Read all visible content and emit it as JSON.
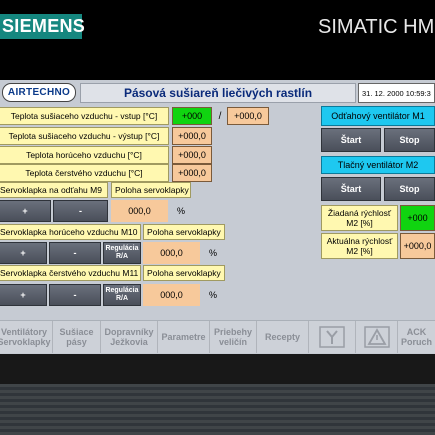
{
  "device": {
    "brand": "SIEMENS",
    "model": "SIMATIC HMI"
  },
  "header": {
    "logo": "AIRTECHNO",
    "title": "Pásová sušiareň liečivých rastlín",
    "datetime": "31. 12. 2000 10:59:3"
  },
  "temperatures": [
    {
      "label": "Teplota sušiaceho vzduchu - vstup [°C]",
      "value": "+000",
      "setpoint": "+000,0",
      "separator": "/"
    },
    {
      "label": "Teplota sušiaceho vzduchu - výstup [°C]",
      "value": "+000,0"
    },
    {
      "label": "Teplota horúceho vzduchu [°C]",
      "value": "+000,0"
    },
    {
      "label": "Teplota čerstvého vzduchu [°C]",
      "value": "+000,0"
    }
  ],
  "dampers": [
    {
      "label": "Servoklapka na odťahu M9",
      "position_label": "Poloha servoklapky",
      "plus": "+",
      "minus": "-",
      "value": "000,0",
      "unit": "%"
    },
    {
      "label": "Servoklapka horúceho vzduchu M10",
      "position_label": "Poloha servoklapky",
      "plus": "+",
      "minus": "-",
      "regulation": "Regulácia R/A",
      "value": "000,0",
      "unit": "%"
    },
    {
      "label": "Servoklapka čerstvého vzduchu M11",
      "position_label": "Poloha servoklapky",
      "plus": "+",
      "minus": "-",
      "regulation": "Regulácia R/A",
      "value": "000,0",
      "unit": "%"
    }
  ],
  "fans": [
    {
      "label": "Odťahový ventilátor M1",
      "start": "Štart",
      "stop": "Stop"
    },
    {
      "label": "Tlačný ventilátor M2",
      "start": "Štart",
      "stop": "Stop"
    }
  ],
  "speed": {
    "desired_label": "Žiadaná rýchlosť M2 [%]",
    "desired_value": "+000",
    "actual_label": "Aktuálna rýchlosť M2 [%]",
    "actual_value": "+000,0"
  },
  "nav": [
    "Ventilátory Servoklapky",
    "Sušiace pásy",
    "Dopravníky Ježkovia",
    "Parametre",
    "Priebehy veličín",
    "Recepty",
    "",
    "",
    "ACK Poruch"
  ],
  "nav_icons": [
    "service-tool-icon",
    "warning-triangle-icon"
  ],
  "colors": {
    "brand": "#15877f",
    "label": "#fff8b0",
    "value": "#f7c99b",
    "active": "#10d410",
    "cyan": "#1ec8f0",
    "button": "#4a4f5a"
  }
}
